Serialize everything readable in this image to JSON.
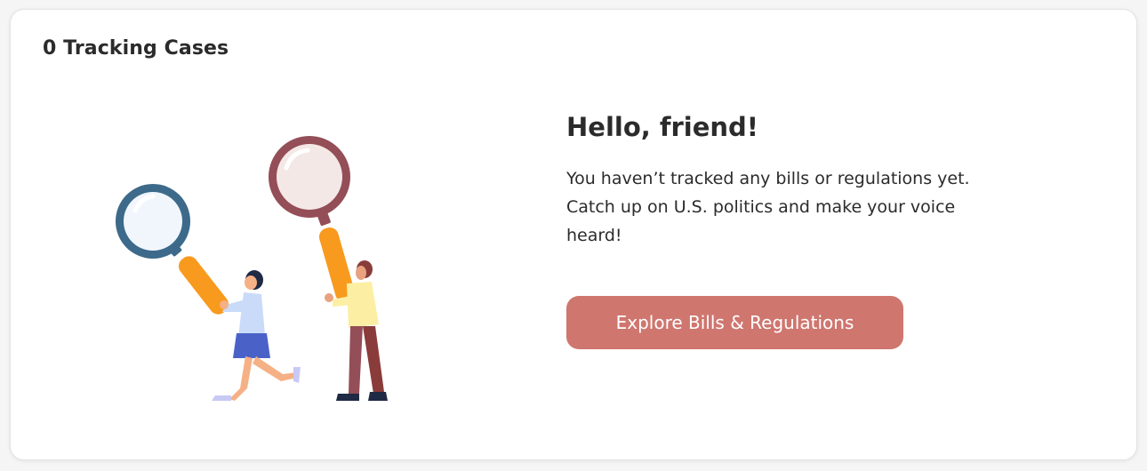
{
  "header": {
    "tracking_count_label": "0 Tracking Cases"
  },
  "empty_state": {
    "illustration": "people-with-magnifying-glasses-illustration",
    "greeting": "Hello, friend!",
    "message": "You haven’t tracked any bills or regulations yet. Catch up on U.S. politics and make your voice heard!",
    "cta_label": "Explore Bills & Regulations"
  },
  "colors": {
    "cta_background": "#cf766f",
    "cta_text": "#ffffff",
    "card_background": "#ffffff",
    "page_background": "#f5f5f5",
    "text": "#2b2b2b",
    "magnifier_blue_frame": "#3d6a8a",
    "magnifier_red_frame": "#944e57",
    "handle_orange": "#f89a1e"
  }
}
